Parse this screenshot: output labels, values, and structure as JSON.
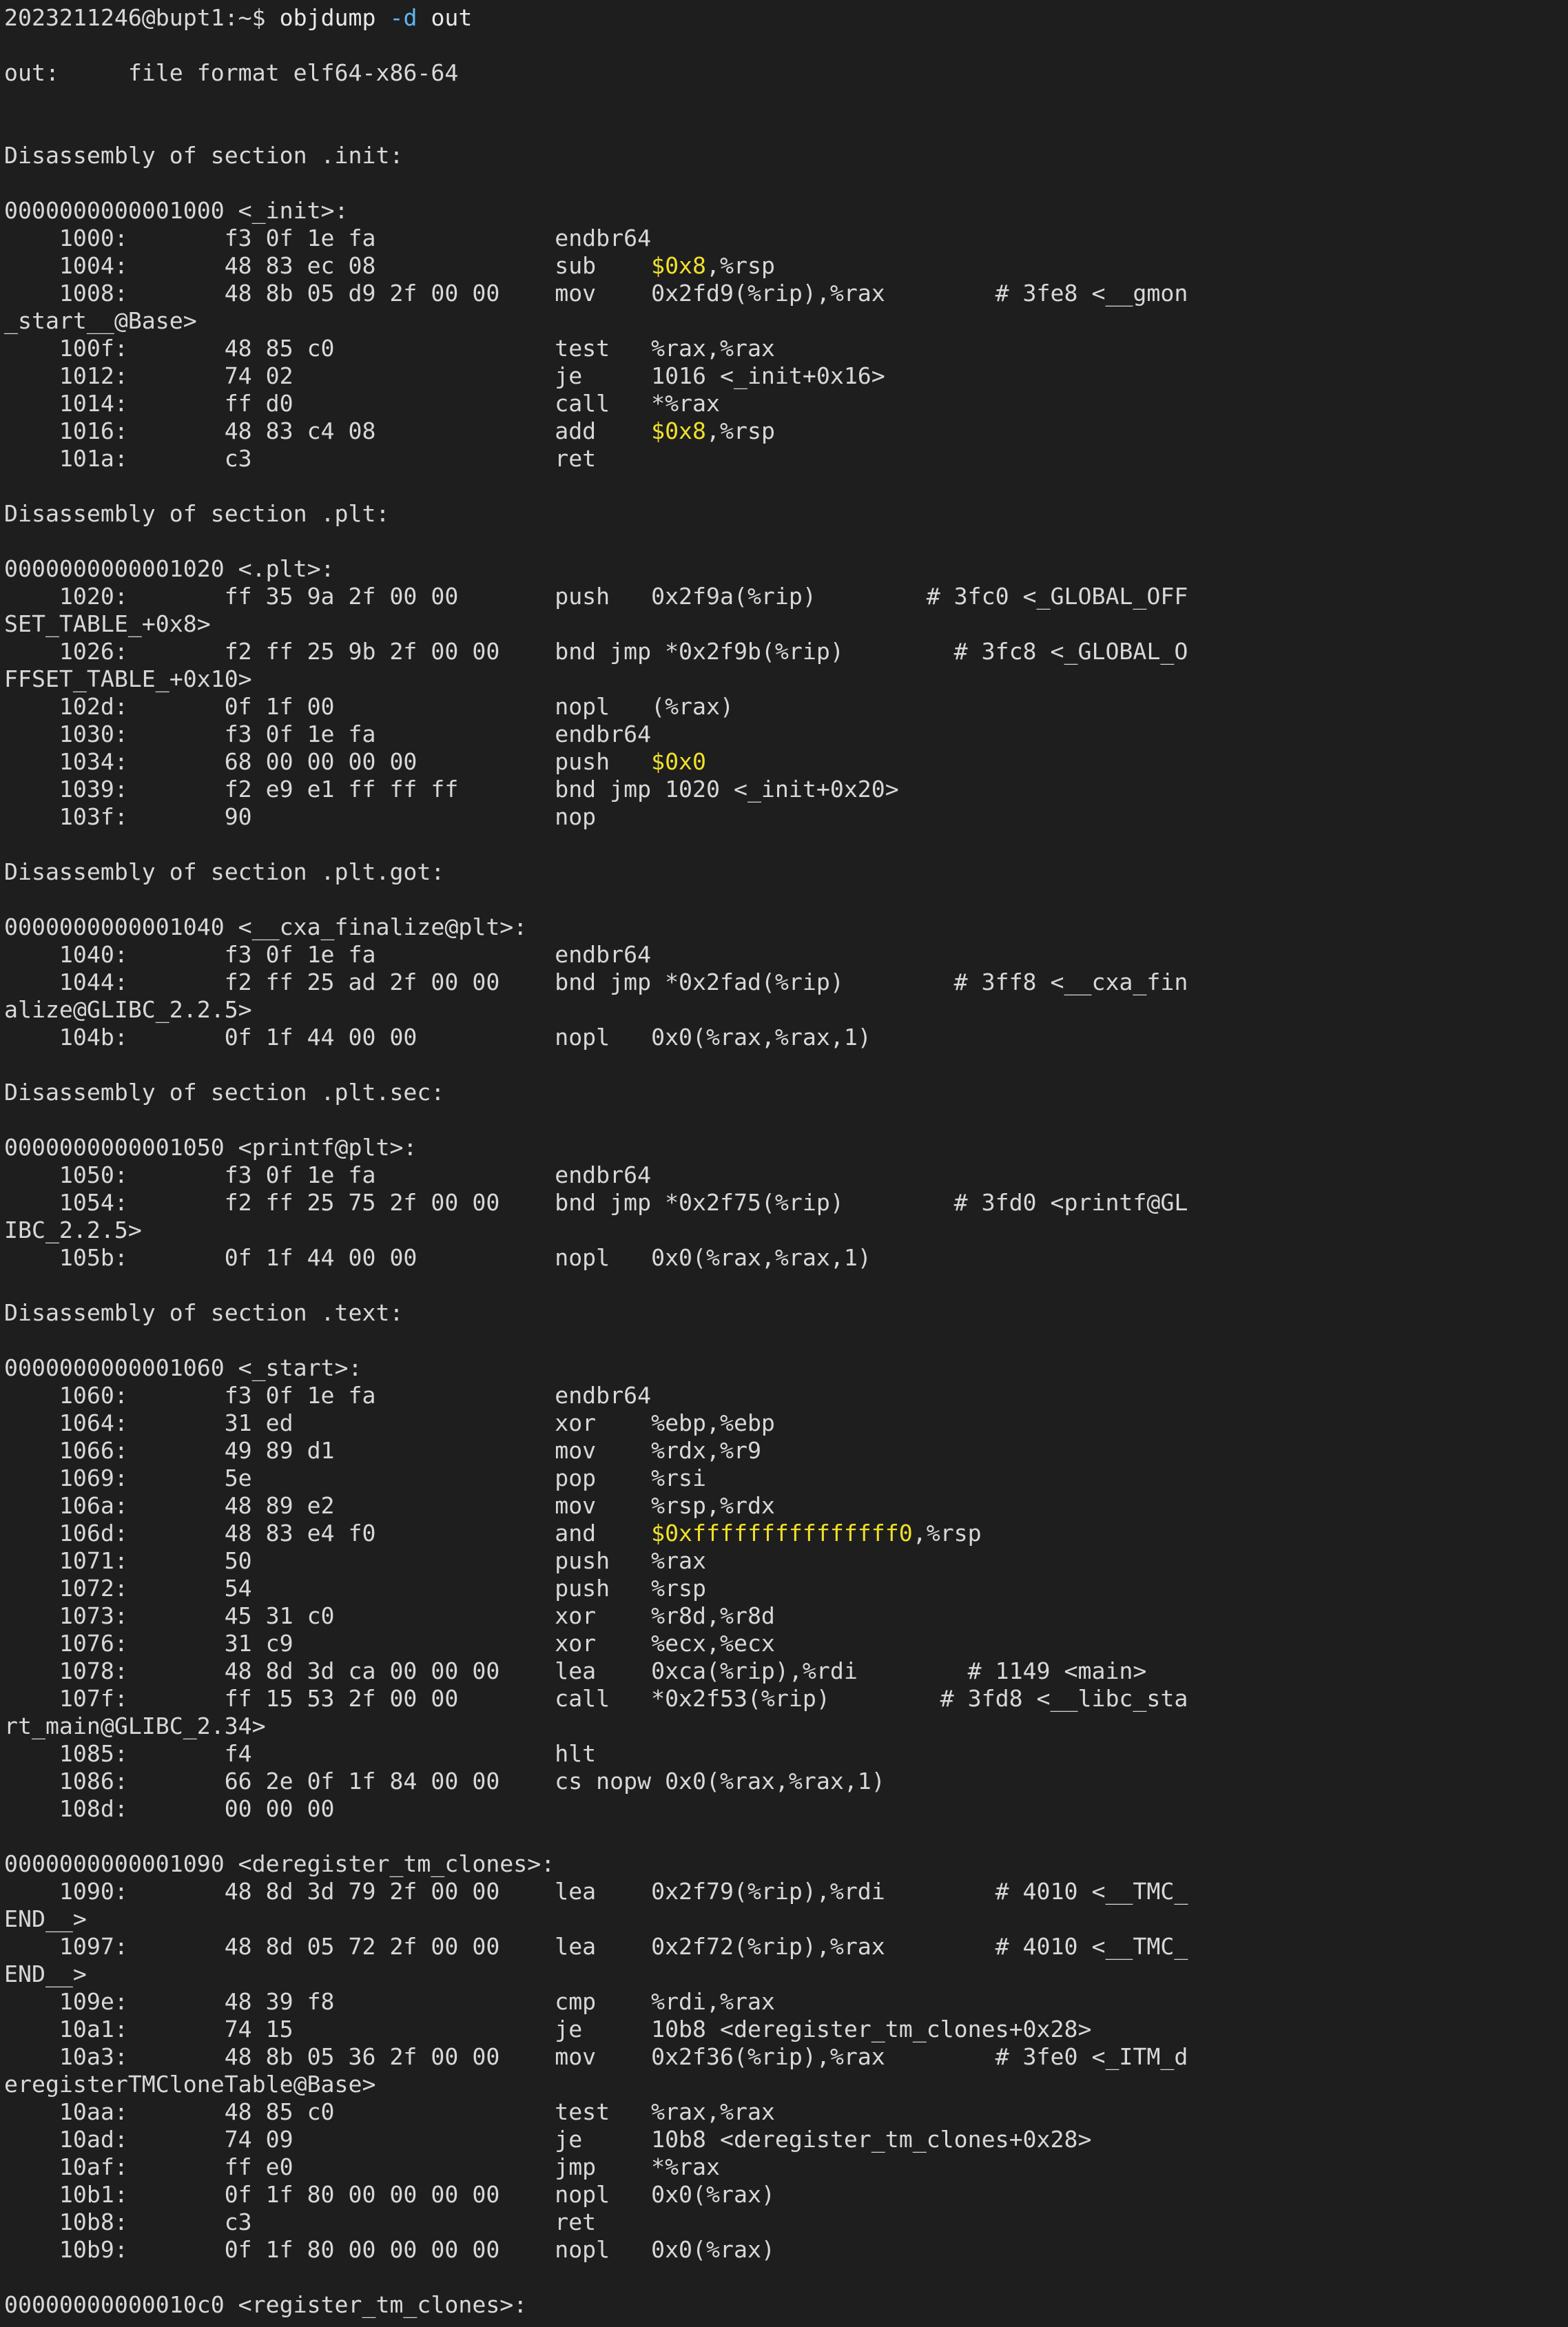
{
  "terminal": {
    "prompt": "2023211246@bupt1:~$ ",
    "command": "objdump",
    "flag": "-d",
    "argument": "out",
    "colors": {
      "background": "#1e1e1e",
      "text": "#d8d8d8",
      "flag": "#5fb7f3",
      "immediate": "#f0e02a"
    }
  },
  "output_lines": [
    [
      [
        "",
        ""
      ]
    ],
    [
      [
        "out:     file format elf64-x86-64",
        ""
      ]
    ],
    [
      [
        "",
        ""
      ]
    ],
    [
      [
        "",
        ""
      ]
    ],
    [
      [
        "Disassembly of section .init:",
        ""
      ]
    ],
    [
      [
        "",
        ""
      ]
    ],
    [
      [
        "0000000000001000 <_init>:",
        ""
      ]
    ],
    [
      [
        "    1000:       f3 0f 1e fa             endbr64",
        ""
      ]
    ],
    [
      [
        "    1004:       48 83 ec 08             sub    ",
        ""
      ],
      [
        "$0x8",
        "imm"
      ],
      [
        ",%rsp",
        ""
      ]
    ],
    [
      [
        "    1008:       48 8b 05 d9 2f 00 00    mov    0x2fd9(%rip),%rax        # 3fe8 <__gmon",
        ""
      ]
    ],
    [
      [
        "_start__@Base>",
        ""
      ]
    ],
    [
      [
        "    100f:       48 85 c0                test   %rax,%rax",
        ""
      ]
    ],
    [
      [
        "    1012:       74 02                   je     1016 <_init+0x16>",
        ""
      ]
    ],
    [
      [
        "    1014:       ff d0                   call   *%rax",
        ""
      ]
    ],
    [
      [
        "    1016:       48 83 c4 08             add    ",
        ""
      ],
      [
        "$0x8",
        "imm"
      ],
      [
        ",%rsp",
        ""
      ]
    ],
    [
      [
        "    101a:       c3                      ret",
        ""
      ]
    ],
    [
      [
        "",
        ""
      ]
    ],
    [
      [
        "Disassembly of section .plt:",
        ""
      ]
    ],
    [
      [
        "",
        ""
      ]
    ],
    [
      [
        "0000000000001020 <.plt>:",
        ""
      ]
    ],
    [
      [
        "    1020:       ff 35 9a 2f 00 00       push   0x2f9a(%rip)        # 3fc0 <_GLOBAL_OFF",
        ""
      ]
    ],
    [
      [
        "SET_TABLE_+0x8>",
        ""
      ]
    ],
    [
      [
        "    1026:       f2 ff 25 9b 2f 00 00    bnd jmp *0x2f9b(%rip)        # 3fc8 <_GLOBAL_O",
        ""
      ]
    ],
    [
      [
        "FFSET_TABLE_+0x10>",
        ""
      ]
    ],
    [
      [
        "    102d:       0f 1f 00                nopl   (%rax)",
        ""
      ]
    ],
    [
      [
        "    1030:       f3 0f 1e fa             endbr64",
        ""
      ]
    ],
    [
      [
        "    1034:       68 00 00 00 00          push   ",
        ""
      ],
      [
        "$0x0",
        "imm"
      ]
    ],
    [
      [
        "    1039:       f2 e9 e1 ff ff ff       bnd jmp 1020 <_init+0x20>",
        ""
      ]
    ],
    [
      [
        "    103f:       90                      nop",
        ""
      ]
    ],
    [
      [
        "",
        ""
      ]
    ],
    [
      [
        "Disassembly of section .plt.got:",
        ""
      ]
    ],
    [
      [
        "",
        ""
      ]
    ],
    [
      [
        "0000000000001040 <__cxa_finalize@plt>:",
        ""
      ]
    ],
    [
      [
        "    1040:       f3 0f 1e fa             endbr64",
        ""
      ]
    ],
    [
      [
        "    1044:       f2 ff 25 ad 2f 00 00    bnd jmp *0x2fad(%rip)        # 3ff8 <__cxa_fin",
        ""
      ]
    ],
    [
      [
        "alize@GLIBC_2.2.5>",
        ""
      ]
    ],
    [
      [
        "    104b:       0f 1f 44 00 00          nopl   0x0(%rax,%rax,1)",
        ""
      ]
    ],
    [
      [
        "",
        ""
      ]
    ],
    [
      [
        "Disassembly of section .plt.sec:",
        ""
      ]
    ],
    [
      [
        "",
        ""
      ]
    ],
    [
      [
        "0000000000001050 <printf@plt>:",
        ""
      ]
    ],
    [
      [
        "    1050:       f3 0f 1e fa             endbr64",
        ""
      ]
    ],
    [
      [
        "    1054:       f2 ff 25 75 2f 00 00    bnd jmp *0x2f75(%rip)        # 3fd0 <printf@GL",
        ""
      ]
    ],
    [
      [
        "IBC_2.2.5>",
        ""
      ]
    ],
    [
      [
        "    105b:       0f 1f 44 00 00          nopl   0x0(%rax,%rax,1)",
        ""
      ]
    ],
    [
      [
        "",
        ""
      ]
    ],
    [
      [
        "Disassembly of section .text:",
        ""
      ]
    ],
    [
      [
        "",
        ""
      ]
    ],
    [
      [
        "0000000000001060 <_start>:",
        ""
      ]
    ],
    [
      [
        "    1060:       f3 0f 1e fa             endbr64",
        ""
      ]
    ],
    [
      [
        "    1064:       31 ed                   xor    %ebp,%ebp",
        ""
      ]
    ],
    [
      [
        "    1066:       49 89 d1                mov    %rdx,%r9",
        ""
      ]
    ],
    [
      [
        "    1069:       5e                      pop    %rsi",
        ""
      ]
    ],
    [
      [
        "    106a:       48 89 e2                mov    %rsp,%rdx",
        ""
      ]
    ],
    [
      [
        "    106d:       48 83 e4 f0             and    ",
        ""
      ],
      [
        "$0xfffffffffffffff0",
        "imm"
      ],
      [
        ",%rsp",
        ""
      ]
    ],
    [
      [
        "    1071:       50                      push   %rax",
        ""
      ]
    ],
    [
      [
        "    1072:       54                      push   %rsp",
        ""
      ]
    ],
    [
      [
        "    1073:       45 31 c0                xor    %r8d,%r8d",
        ""
      ]
    ],
    [
      [
        "    1076:       31 c9                   xor    %ecx,%ecx",
        ""
      ]
    ],
    [
      [
        "    1078:       48 8d 3d ca 00 00 00    lea    0xca(%rip),%rdi        # 1149 <main>",
        ""
      ]
    ],
    [
      [
        "    107f:       ff 15 53 2f 00 00       call   *0x2f53(%rip)        # 3fd8 <__libc_sta",
        ""
      ]
    ],
    [
      [
        "rt_main@GLIBC_2.34>",
        ""
      ]
    ],
    [
      [
        "    1085:       f4                      hlt",
        ""
      ]
    ],
    [
      [
        "    1086:       66 2e 0f 1f 84 00 00    cs nopw 0x0(%rax,%rax,1)",
        ""
      ]
    ],
    [
      [
        "    108d:       00 00 00",
        ""
      ]
    ],
    [
      [
        "",
        ""
      ]
    ],
    [
      [
        "0000000000001090 <deregister_tm_clones>:",
        ""
      ]
    ],
    [
      [
        "    1090:       48 8d 3d 79 2f 00 00    lea    0x2f79(%rip),%rdi        # 4010 <__TMC_",
        ""
      ]
    ],
    [
      [
        "END__>",
        ""
      ]
    ],
    [
      [
        "    1097:       48 8d 05 72 2f 00 00    lea    0x2f72(%rip),%rax        # 4010 <__TMC_",
        ""
      ]
    ],
    [
      [
        "END__>",
        ""
      ]
    ],
    [
      [
        "    109e:       48 39 f8                cmp    %rdi,%rax",
        ""
      ]
    ],
    [
      [
        "    10a1:       74 15                   je     10b8 <deregister_tm_clones+0x28>",
        ""
      ]
    ],
    [
      [
        "    10a3:       48 8b 05 36 2f 00 00    mov    0x2f36(%rip),%rax        # 3fe0 <_ITM_d",
        ""
      ]
    ],
    [
      [
        "eregisterTMCloneTable@Base>",
        ""
      ]
    ],
    [
      [
        "    10aa:       48 85 c0                test   %rax,%rax",
        ""
      ]
    ],
    [
      [
        "    10ad:       74 09                   je     10b8 <deregister_tm_clones+0x28>",
        ""
      ]
    ],
    [
      [
        "    10af:       ff e0                   jmp    *%rax",
        ""
      ]
    ],
    [
      [
        "    10b1:       0f 1f 80 00 00 00 00    nopl   0x0(%rax)",
        ""
      ]
    ],
    [
      [
        "    10b8:       c3                      ret",
        ""
      ]
    ],
    [
      [
        "    10b9:       0f 1f 80 00 00 00 00    nopl   0x0(%rax)",
        ""
      ]
    ],
    [
      [
        "",
        ""
      ]
    ],
    [
      [
        "00000000000010c0 <register_tm_clones>:",
        ""
      ]
    ]
  ]
}
